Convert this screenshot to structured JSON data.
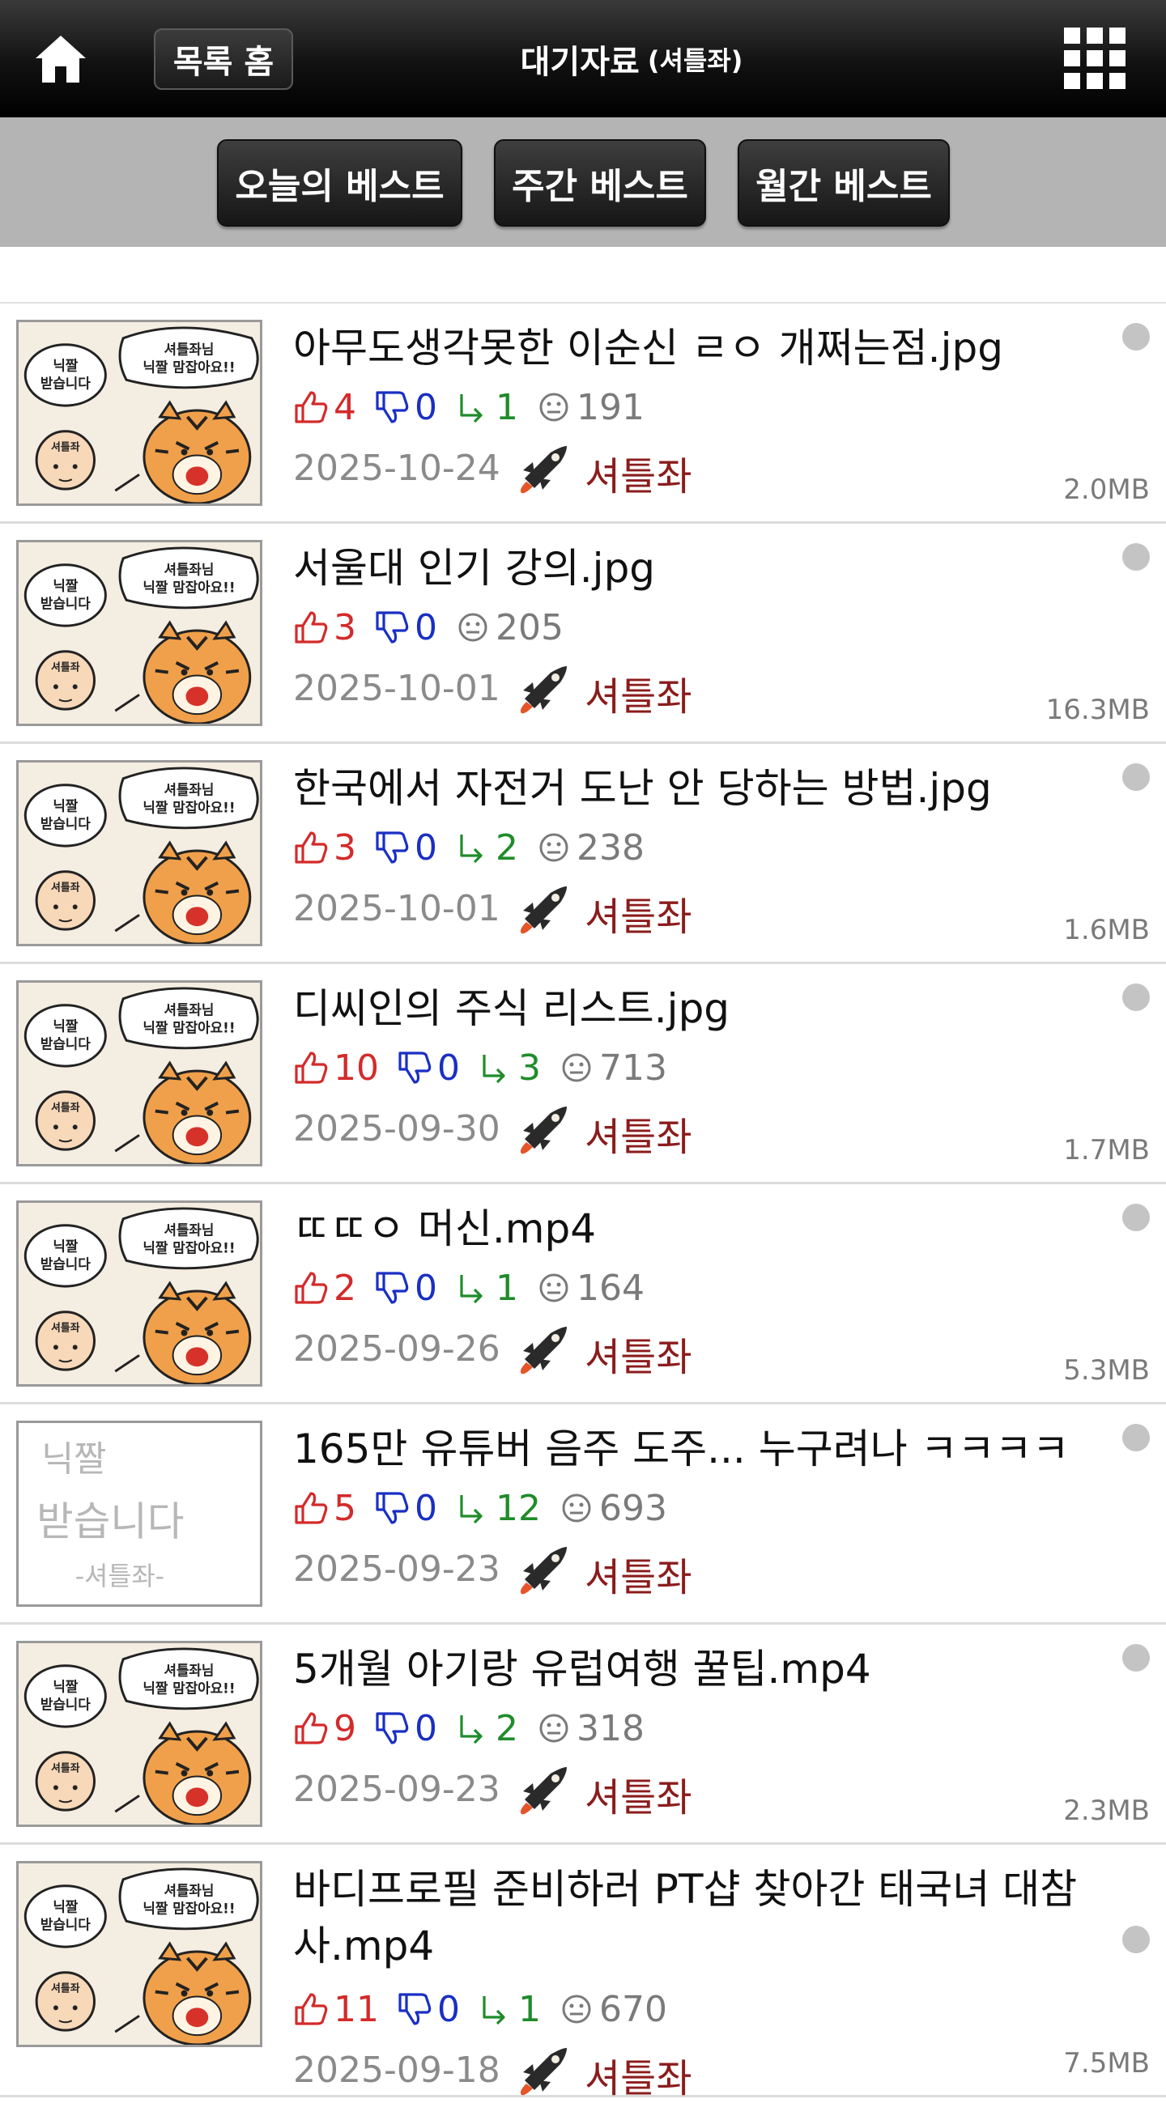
{
  "header": {
    "home_icon": "home-icon",
    "list_home_label": "목록 홈",
    "title": "대기자료",
    "title_sub": "(셔틀좌)",
    "menu_icon": "grid-menu-icon"
  },
  "best_tabs": [
    "오늘의 베스트",
    "주간 베스트",
    "월간 베스트"
  ],
  "thumbnail_texts": {
    "bubble_left": "닉짤 받습니다",
    "bubble_right": "셔틀좌님 닉짤 맘잡아요!!",
    "bald_label": "셔틀좌",
    "sketch_line1": "닉짤",
    "sketch_line2": "받습니다",
    "sketch_line3": "-셔틀좌-"
  },
  "posts": [
    {
      "title": "아무도생각못한 이순신 ㄹㅇ 개쩌는점.jpg",
      "likes": "4",
      "dislikes": "0",
      "replies": "1",
      "views": "191",
      "date": "2025-10-24",
      "author": "셔틀좌",
      "size": "2.0MB",
      "thumb": "comic"
    },
    {
      "title": "서울대 인기 강의.jpg",
      "likes": "3",
      "dislikes": "0",
      "replies": null,
      "views": "205",
      "date": "2025-10-01",
      "author": "셔틀좌",
      "size": "16.3MB",
      "thumb": "comic"
    },
    {
      "title": "한국에서 자전거 도난 안 당하는 방법.jpg",
      "likes": "3",
      "dislikes": "0",
      "replies": "2",
      "views": "238",
      "date": "2025-10-01",
      "author": "셔틀좌",
      "size": "1.6MB",
      "thumb": "comic"
    },
    {
      "title": "디씨인의 주식 리스트.jpg",
      "likes": "10",
      "dislikes": "0",
      "replies": "3",
      "views": "713",
      "date": "2025-09-30",
      "author": "셔틀좌",
      "size": "1.7MB",
      "thumb": "comic"
    },
    {
      "title": "ㄸㄸㅇ 머신.mp4",
      "likes": "2",
      "dislikes": "0",
      "replies": "1",
      "views": "164",
      "date": "2025-09-26",
      "author": "셔틀좌",
      "size": "5.3MB",
      "thumb": "comic"
    },
    {
      "title": "165만 유튜버 음주 도주... 누구려나 ㅋㅋㅋㅋ",
      "likes": "5",
      "dislikes": "0",
      "replies": "12",
      "views": "693",
      "date": "2025-09-23",
      "author": "셔틀좌",
      "size": "",
      "thumb": "sketch"
    },
    {
      "title": "5개월 아기랑 유럽여행 꿀팁.mp4",
      "likes": "9",
      "dislikes": "0",
      "replies": "2",
      "views": "318",
      "date": "2025-09-23",
      "author": "셔틀좌",
      "size": "2.3MB",
      "thumb": "comic"
    },
    {
      "title": "바디프로필 준비하러 PT샵 찾아간 태국녀 대참사.mp4",
      "likes": "11",
      "dislikes": "0",
      "replies": "1",
      "views": "670",
      "date": "2025-09-18",
      "author": "셔틀좌",
      "size": "7.5MB",
      "thumb": "comic"
    }
  ],
  "colors": {
    "like": "#d42a2a",
    "dislike": "#1a2fc4",
    "reply": "#1f8c2a",
    "author": "#8b1c1c"
  }
}
